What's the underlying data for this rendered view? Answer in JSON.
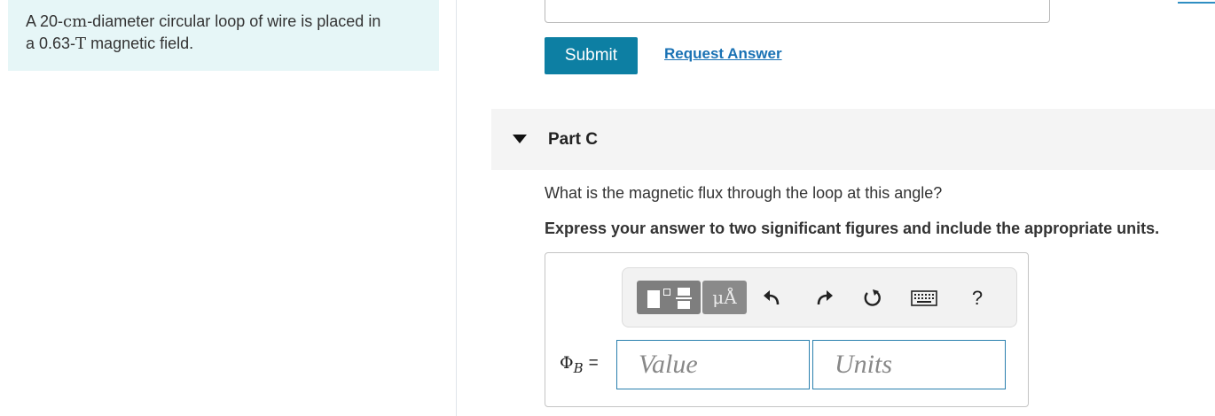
{
  "intro": {
    "line1_prefix": "A 20-",
    "line1_unit": "cm",
    "line1_suffix": "-diameter circular loop of wire is placed in",
    "line2_prefix": "a 0.63-",
    "line2_unit": "T",
    "line2_suffix": " magnetic field."
  },
  "actions": {
    "submit_label": "Submit",
    "request_label": "Request Answer"
  },
  "part": {
    "title": "Part C",
    "question": "What is the magnetic flux through the loop at this angle?",
    "instruction": "Express your answer to two significant figures and include the appropriate units."
  },
  "toolbar": {
    "units_label": "μÅ",
    "help_label": "?",
    "icons": [
      "templates-icon",
      "units-icon",
      "undo-icon",
      "redo-icon",
      "reset-icon",
      "keyboard-icon",
      "help-icon"
    ]
  },
  "answer": {
    "symbol": "Φ",
    "subscript": "B",
    "equals": "=",
    "value_placeholder": "Value",
    "units_placeholder": "Units"
  },
  "colors": {
    "accent": "#0d7fa3",
    "link": "#1a72b4",
    "intro_bg": "#e6f6f7",
    "part_bg": "#f4f4f4"
  }
}
